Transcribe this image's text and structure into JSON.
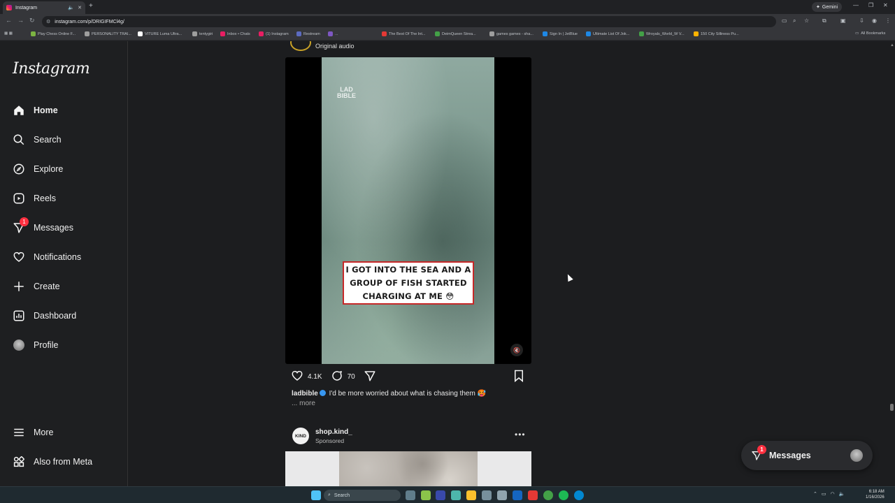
{
  "browser": {
    "tab_title": "Instagram",
    "new_tab": "+",
    "gemini_label": "Gemini",
    "url": "instagram.com/p/DRIGIFMCl4g/",
    "bookmarks": [
      {
        "label": "Play Chess Online F...",
        "color": "#7cb342"
      },
      {
        "label": "PERSONALITY TRAI...",
        "color": "#9e9e9e"
      },
      {
        "label": "VITURE Luma Ultra...",
        "color": "#ffffff"
      },
      {
        "label": "tentygiri",
        "color": "#9e9e9e"
      },
      {
        "label": "Inbox • Chats",
        "color": "#e91e63"
      },
      {
        "label": "(1) Instagram",
        "color": "#e91e63"
      },
      {
        "label": "Restream",
        "color": "#5c6bc0"
      },
      {
        "label": "...",
        "color": "#7e57c2"
      },
      {
        "label": "The Best Of The Int...",
        "color": "#e53935"
      },
      {
        "label": "DeimQueen Strea...",
        "color": "#43a047"
      },
      {
        "label": "games games - sha...",
        "color": "#9e9e9e"
      },
      {
        "label": "Sign In | JetBlue",
        "color": "#1e88e5"
      },
      {
        "label": "Ultimate List Of Jok...",
        "color": "#1e88e5"
      },
      {
        "label": "Wroyals_World_W V...",
        "color": "#43a047"
      },
      {
        "label": "150 City Silliness Pu...",
        "color": "#ffb300"
      }
    ],
    "all_bookmarks": "All Bookmarks"
  },
  "sidebar": {
    "logo": "Instagram",
    "items": [
      {
        "label": "Home",
        "icon": "home-icon"
      },
      {
        "label": "Search",
        "icon": "search-icon"
      },
      {
        "label": "Explore",
        "icon": "compass-icon"
      },
      {
        "label": "Reels",
        "icon": "reels-icon"
      },
      {
        "label": "Messages",
        "icon": "messenger-icon",
        "badge": "1"
      },
      {
        "label": "Notifications",
        "icon": "heart-icon"
      },
      {
        "label": "Create",
        "icon": "plus-icon"
      },
      {
        "label": "Dashboard",
        "icon": "dashboard-icon"
      },
      {
        "label": "Profile",
        "icon": "avatar"
      },
      {
        "label": "More",
        "icon": "menu-icon"
      },
      {
        "label": "Also from Meta",
        "icon": "meta-icon"
      }
    ]
  },
  "post": {
    "audio": "Original audio",
    "video": {
      "watermark_top": "LAD",
      "watermark_bottom": "BIBLE",
      "caption_text": "I GOT INTO THE SEA AND A GROUP OF FISH STARTED CHARGING AT ME 😳"
    },
    "likes": "4.1K",
    "comments": "70",
    "username": "ladbible",
    "caption": "I'd be more worried about what is chasing them 🥵",
    "more": "... more"
  },
  "post2": {
    "avatar_text": "KIND",
    "username": "shop.kind_",
    "sponsored": "Sponsored",
    "menu": "•••"
  },
  "floating_messages": {
    "label": "Messages",
    "badge": "1"
  },
  "taskbar": {
    "search_label": "Search",
    "time": "6:18 AM",
    "date": "1/16/2026"
  }
}
